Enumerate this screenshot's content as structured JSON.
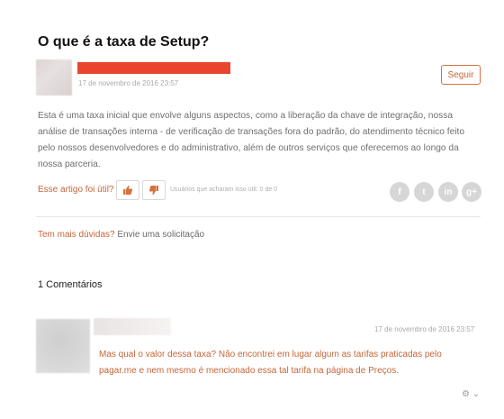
{
  "article": {
    "title": "O que é a taxa de Setup?",
    "date": "17 de novembro de 2016 23:57",
    "follow_label": "Seguir",
    "body": "Esta é uma taxa inicial que envolve alguns aspectos, como a liberação da chave de integração, nossa análise de transações interna - de verificação de transações fora do padrão, do atendimento técnico feito pelo nossos desenvolvedores e do administrativo, além de outros serviços que oferecemos ao longo da nossa parceria."
  },
  "vote": {
    "question": "Esse artigo foi útil?",
    "count_text": "Usuários que acharam isso útil: 0 de 0"
  },
  "social": {
    "facebook": "f",
    "twitter": "t",
    "linkedin": "in",
    "googleplus": "g+"
  },
  "help": {
    "question": "Tem mais dúvidas?",
    "link": "Envie uma solicitação"
  },
  "comments": {
    "heading": "1 Comentários",
    "items": [
      {
        "date": "17 de novembro de 2016 23:57",
        "text": "Mas qual o valor dessa taxa? Não encontrei em lugar algum as tarifas praticadas pelo pagar.me e nem mesmo é mencionado essa tal tarifa na página de Preços."
      }
    ]
  },
  "settings": {
    "label": "⚙ ⌄"
  },
  "colors": {
    "accent": "#c4663a",
    "author_bar": "#e8442e"
  }
}
